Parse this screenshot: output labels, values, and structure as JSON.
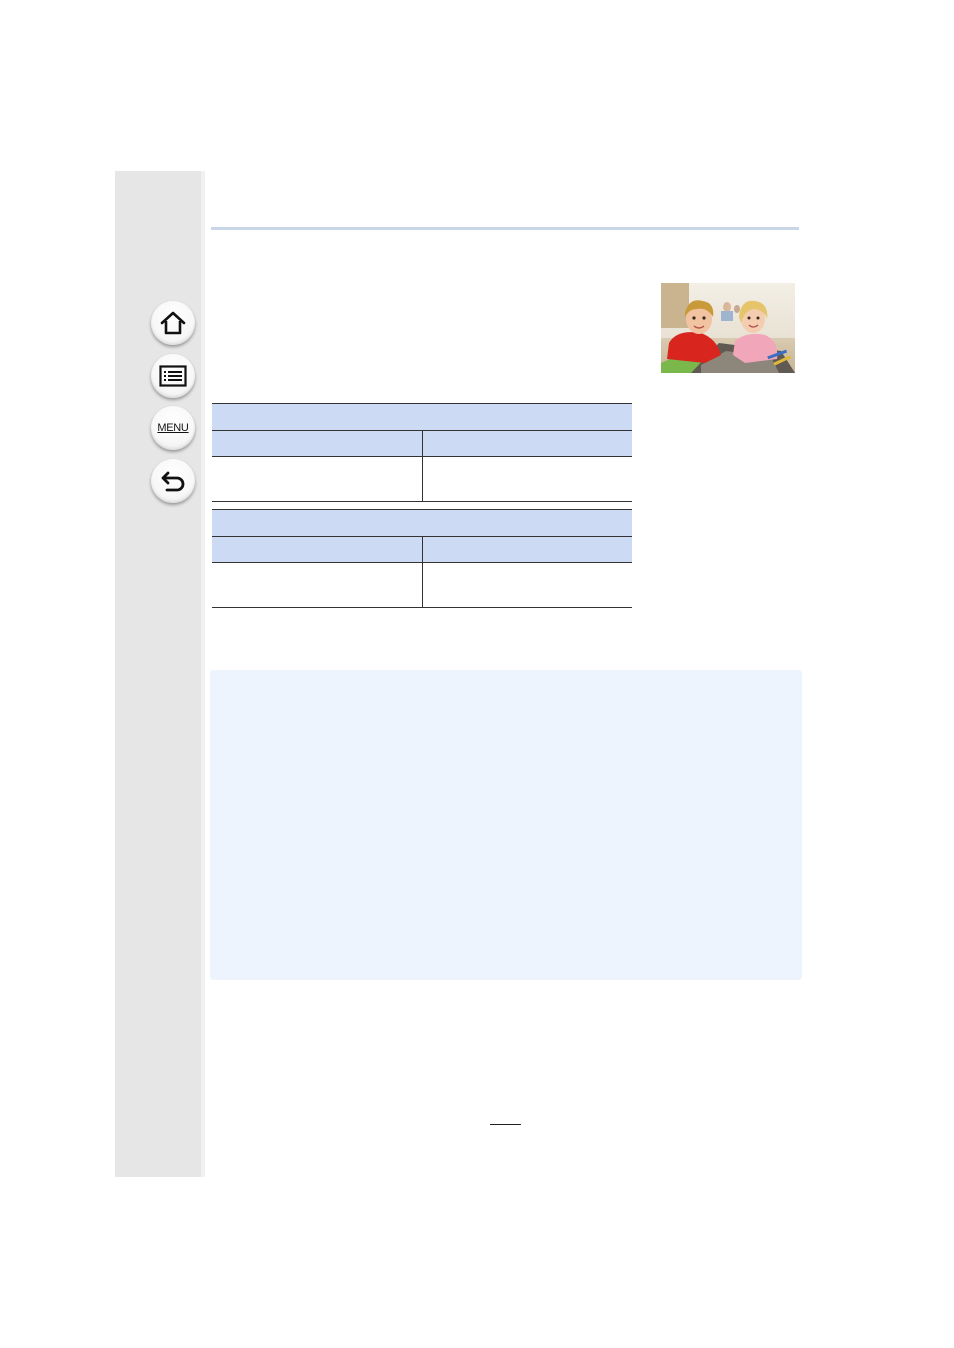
{
  "sidebar": {
    "buttons": [
      {
        "icon": "home-icon"
      },
      {
        "icon": "contents-list-icon"
      },
      {
        "icon": "menu-icon",
        "label": "MENU"
      },
      {
        "icon": "back-icon"
      }
    ],
    "color": "#e6e6e6"
  },
  "header": {
    "rule_color": "#c9d6e8"
  },
  "photo": {
    "subject": "children-photo"
  },
  "tables": [
    {
      "header": "",
      "columns": [
        "",
        ""
      ],
      "row": [
        "",
        ""
      ]
    },
    {
      "header": "",
      "columns": [
        "",
        ""
      ],
      "row": [
        "",
        ""
      ]
    }
  ],
  "info_box": {
    "color": "#edf4fd",
    "text": ""
  },
  "footer": {
    "page_number": ""
  },
  "colors": {
    "table_header": "#cddaf3",
    "info_box": "#edf4fd"
  }
}
